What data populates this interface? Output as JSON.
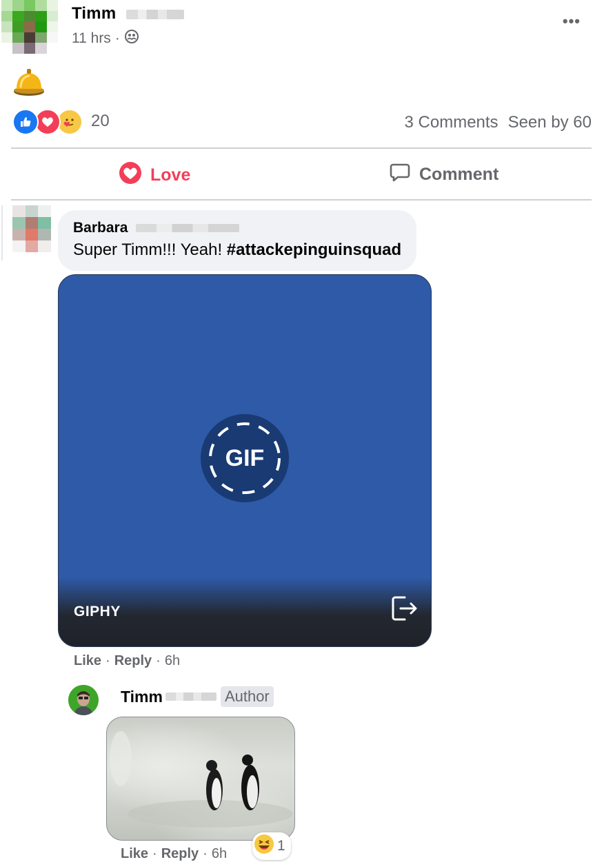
{
  "post": {
    "author": "Timm",
    "time": "11 hrs",
    "separator": "·",
    "reaction_count": "20",
    "comments_count": "3 Comments",
    "seen_by": "Seen by 60",
    "icons": {
      "privacy": "friends-icon",
      "more": "more-options-icon",
      "content": "bell-emoji-icon"
    }
  },
  "actions": {
    "love_label": "Love",
    "comment_label": "Comment"
  },
  "comment": {
    "author": "Barbara",
    "text_plain": "Super Timm!!! Yeah! ",
    "hashtag": "#attackepinguinsquad",
    "gif_badge": "GIF",
    "gif_provider": "GIPHY",
    "like": "Like",
    "reply": "Reply",
    "dot": "·",
    "time": "6h"
  },
  "reply": {
    "author": "Timm",
    "badge": "Author",
    "like": "Like",
    "reply": "Reply",
    "dot": "·",
    "time": "6h",
    "reaction_count": "1"
  },
  "colors": {
    "love_red": "#f33e58",
    "like_blue": "#1877f2",
    "gif_blue": "#2e5aa7",
    "secondary_text": "#65676b"
  }
}
